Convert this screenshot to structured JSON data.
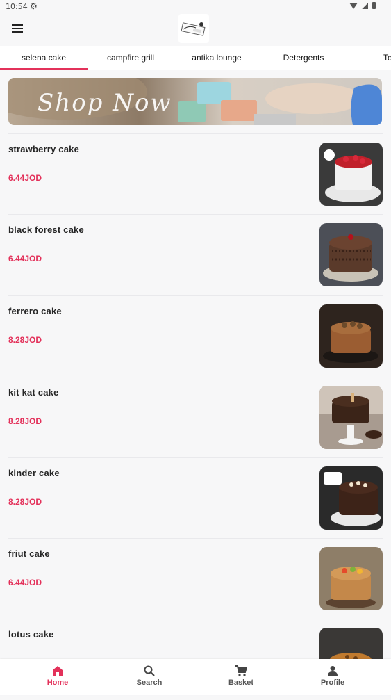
{
  "status_bar": {
    "time": "10:54"
  },
  "tabs": [
    {
      "label": "selena cake"
    },
    {
      "label": "campfire grill"
    },
    {
      "label": "antika lounge"
    },
    {
      "label": "Detergents"
    },
    {
      "label": "To"
    }
  ],
  "banner": {
    "text": "Shop Now"
  },
  "products": [
    {
      "name": "strawberry cake",
      "price": "6.44JOD"
    },
    {
      "name": "black forest cake",
      "price": "6.44JOD"
    },
    {
      "name": "ferrero cake",
      "price": "8.28JOD"
    },
    {
      "name": "kit kat cake",
      "price": "8.28JOD"
    },
    {
      "name": "kinder cake",
      "price": "8.28JOD"
    },
    {
      "name": "friut cake",
      "price": "6.44JOD"
    },
    {
      "name": "lotus cake",
      "price": ""
    }
  ],
  "bottom_nav": {
    "home": "Home",
    "search": "Search",
    "basket": "Basket",
    "profile": "Profile"
  },
  "colors": {
    "accent": "#e3315a"
  }
}
